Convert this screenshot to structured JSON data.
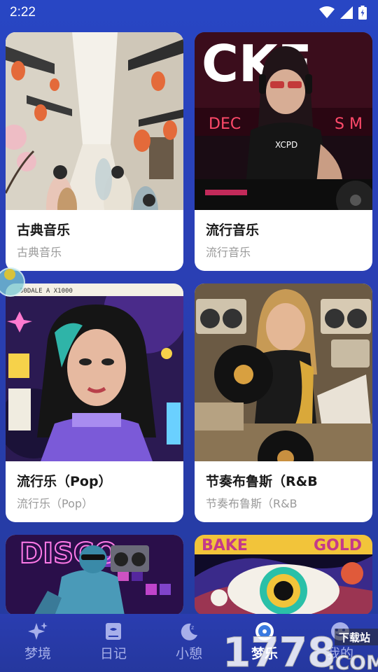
{
  "status_bar": {
    "time": "2:22"
  },
  "cards": [
    {
      "title": "古典音乐",
      "subtitle": "古典音乐",
      "image": "classical-chinese-street-illustration"
    },
    {
      "title": "流行音乐",
      "subtitle": "流行音乐",
      "image": "dj-girl-photo",
      "image_text": "CKE"
    },
    {
      "title": "流行乐（Pop）",
      "subtitle": "流行乐（Pop）",
      "image": "pop-art-girl-illustration"
    },
    {
      "title": "节奏布鲁斯（R&B",
      "subtitle": "节奏布鲁斯（R&B",
      "image": "saxophone-vinyl-photo"
    },
    {
      "title": "",
      "subtitle": "",
      "image": "disco-terracotta-warrior"
    },
    {
      "title": "",
      "subtitle": "",
      "image": "psychedelic-eye-poster"
    }
  ],
  "nav": [
    {
      "label": "梦境",
      "icon": "sparkle-icon"
    },
    {
      "label": "日记",
      "icon": "book-icon"
    },
    {
      "label": "小憩",
      "icon": "moon-icon"
    },
    {
      "label": "梦乐",
      "icon": "music-disc-icon",
      "active": true
    },
    {
      "label": "我的",
      "icon": "face-icon"
    }
  ],
  "watermark": {
    "number": "1778",
    "site": ".COM",
    "tag": "下载站"
  },
  "colors": {
    "background": "#2a3fb4",
    "card": "#ffffff",
    "title": "#1a1a1a",
    "subtitle": "#9a9a9a"
  }
}
